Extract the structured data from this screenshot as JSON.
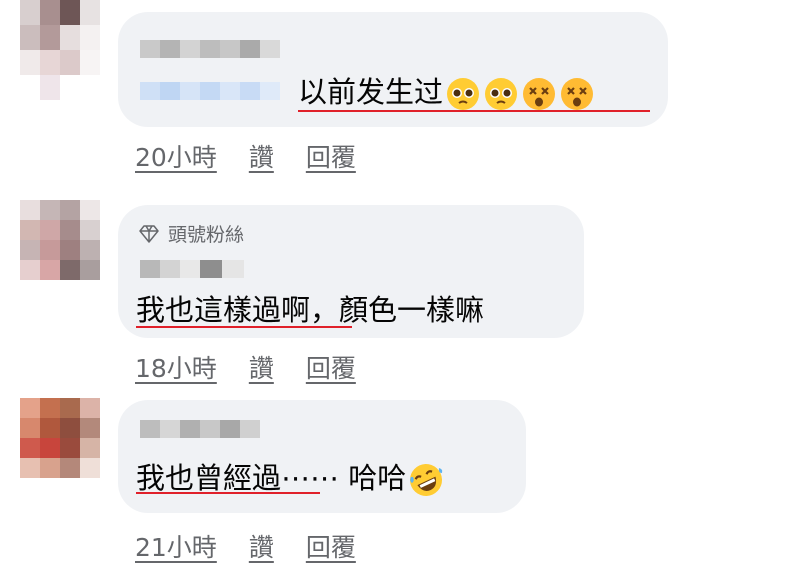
{
  "comments": [
    {
      "badge": "",
      "text": "以前发生过",
      "emojis": [
        "pleading-face",
        "pleading-face",
        "dizzy-face",
        "dizzy-face"
      ],
      "time": "20小時",
      "like": "讚",
      "reply": "回覆"
    },
    {
      "badge": "頭號粉絲",
      "text": "我也這樣過啊，顏色一樣嘛",
      "emojis": [],
      "time": "18小時",
      "like": "讚",
      "reply": "回覆"
    },
    {
      "badge": "",
      "text": "我也曾經過⋯⋯ 哈哈",
      "emojis": [
        "rolling-on-floor-laughing"
      ],
      "time": "21小時",
      "like": "讚",
      "reply": "回覆"
    }
  ],
  "colors": {
    "bubble": "#f0f2f5",
    "underline_red": "#e0202a",
    "meta_gray": "#65676b"
  }
}
